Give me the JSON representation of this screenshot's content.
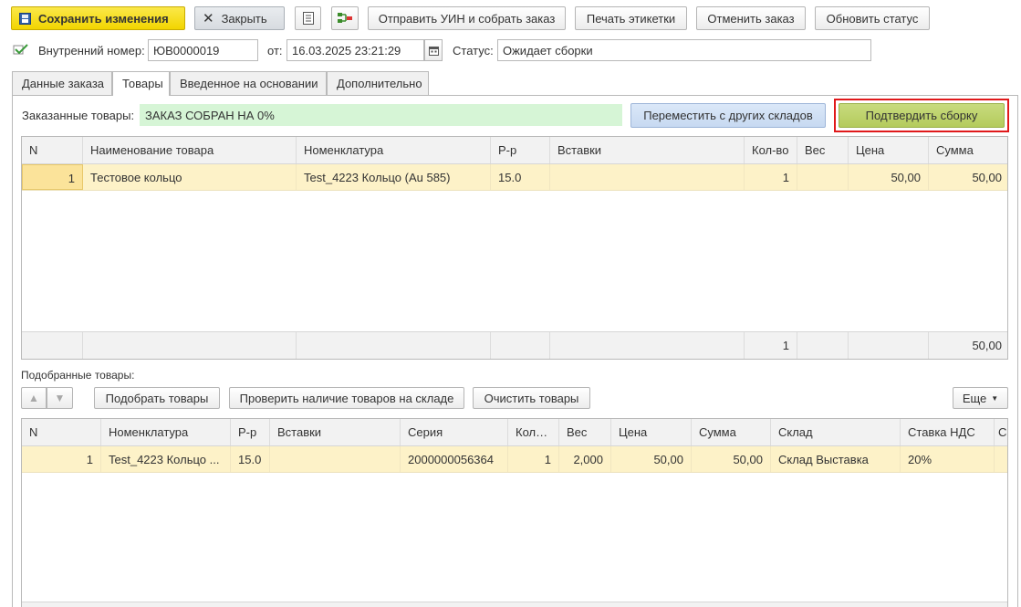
{
  "toolbar": {
    "save_label": "Сохранить изменения",
    "close_label": "Закрыть",
    "send_label": "Отправить УИН и собрать заказ",
    "print_label": "Печать этикетки",
    "cancel_label": "Отменить заказ",
    "refresh_label": "Обновить статус"
  },
  "header": {
    "internal_number_label": "Внутренний номер:",
    "internal_number_value": "ЮВ0000019",
    "date_label": "от:",
    "date_value": "16.03.2025 23:21:29",
    "status_label": "Статус:",
    "status_value": "Ожидает сборки"
  },
  "tabs": [
    {
      "label": "Данные заказа"
    },
    {
      "label": "Товары"
    },
    {
      "label": "Введенное на основании"
    },
    {
      "label": "Дополнительно"
    }
  ],
  "ordered": {
    "label": "Заказанные товары:",
    "progress_text": "ЗАКАЗ СОБРАН НА 0%",
    "move_button": "Переместить с других складов",
    "confirm_button": "Подтвердить сборку",
    "columns": [
      "N",
      "Наименование товара",
      "Номенклатура",
      "Р-р",
      "Вставки",
      "Кол-во",
      "Вес",
      "Цена",
      "Сумма"
    ],
    "rows": [
      {
        "n": "1",
        "name": "Тестовое кольцо",
        "nomenclature": "Test_4223 Кольцо (Au 585)",
        "size": "15.0",
        "inserts": "",
        "qty": "1",
        "weight": "",
        "price": "50,00",
        "sum": "50,00"
      }
    ],
    "totals": {
      "qty": "1",
      "sum": "50,00"
    }
  },
  "picked": {
    "label": "Подобранные товары:",
    "pick_button": "Подобрать товары",
    "check_button": "Проверить наличие товаров на складе",
    "clear_button": "Очистить товары",
    "more_button": "Еще",
    "columns": [
      "N",
      "Номенклатура",
      "Р-р",
      "Вставки",
      "Серия",
      "Кол-во",
      "Вес",
      "Цена",
      "Сумма",
      "Склад",
      "Ставка НДС",
      "С"
    ],
    "rows": [
      {
        "n": "1",
        "nomenclature": "Test_4223 Кольцо ...",
        "size": "15.0",
        "inserts": "",
        "series": "2000000056364",
        "qty": "1",
        "weight": "2,000",
        "price": "50,00",
        "sum": "50,00",
        "warehouse": "Склад Выставка",
        "vat": "20%",
        "extra": ""
      }
    ]
  },
  "colors": {
    "save_yellow": "#f2d500",
    "confirm_green": "#b4cb5c",
    "highlight_red": "#e0191b",
    "progress_bg": "#d6f5d6",
    "row_selected": "#fdf2c8"
  }
}
